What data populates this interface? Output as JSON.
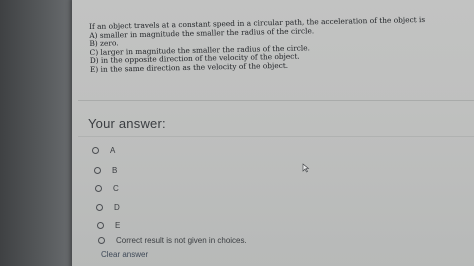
{
  "question": {
    "lines": [
      "If an object travels at a constant speed in a circular path, the acceleration of the object is",
      "A) smaller in magnitude the smaller the radius of the circle.",
      "B) zero.",
      "C) larger in magnitude the smaller the radius of the circle.",
      "D) in the opposite direction of the velocity of the object.",
      "E) in the same direction as the velocity of the object."
    ]
  },
  "answer_section": {
    "label": "Your answer:"
  },
  "options": [
    {
      "label": "A",
      "selected": false
    },
    {
      "label": "B",
      "selected": false
    },
    {
      "label": "C",
      "selected": false
    },
    {
      "label": "D",
      "selected": false
    },
    {
      "label": "E",
      "selected": false
    },
    {
      "label": "Correct result is not given in choices.",
      "selected": false
    }
  ],
  "clear_answer": {
    "label": "Clear answer"
  },
  "icons": {
    "cursor": "mouse-pointer-icon",
    "radio": "radio-circle-icon"
  }
}
